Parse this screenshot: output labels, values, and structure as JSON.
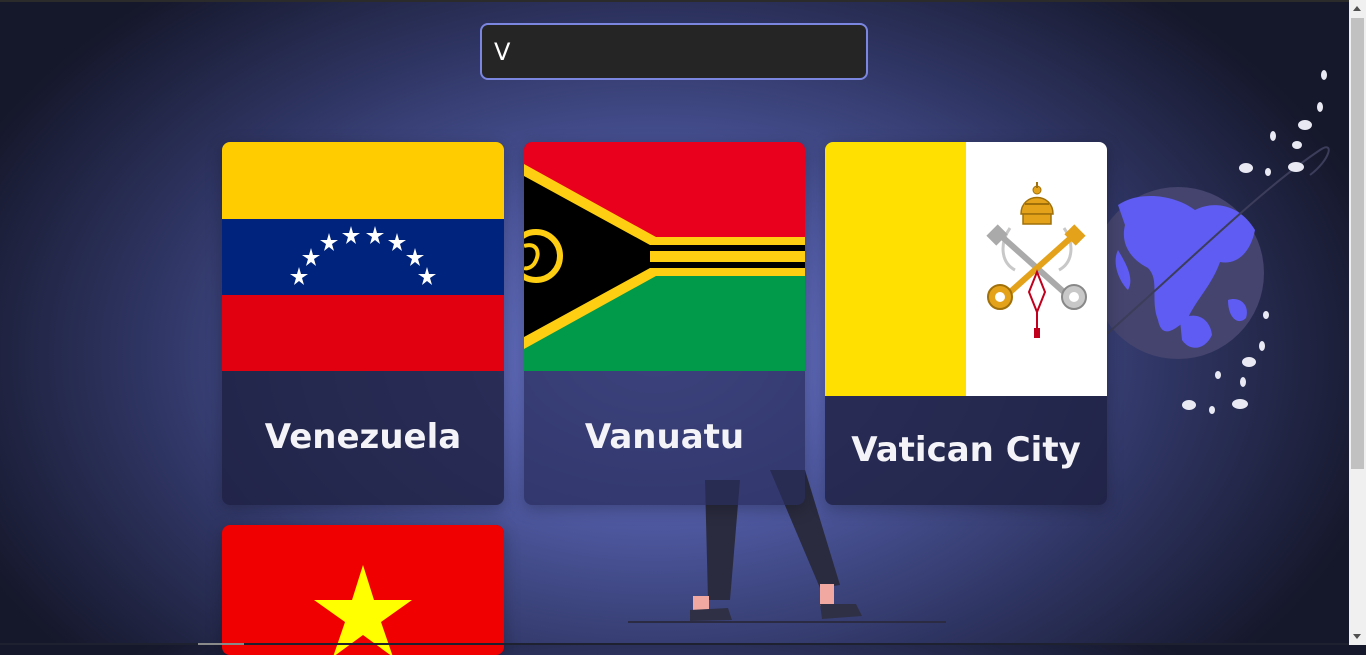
{
  "search": {
    "value": "V"
  },
  "countries": [
    {
      "name": "Venezuela",
      "flag_icon": "venezuela-flag"
    },
    {
      "name": "Vanuatu",
      "flag_icon": "vanuatu-flag"
    },
    {
      "name": "Vatican City",
      "flag_icon": "vatican-city-flag"
    },
    {
      "name": "",
      "flag_icon": "vietnam-flag"
    }
  ],
  "colors": {
    "accent": "#7b86e0",
    "globe": "#6a67ff",
    "card_bg": "#1e2142"
  }
}
